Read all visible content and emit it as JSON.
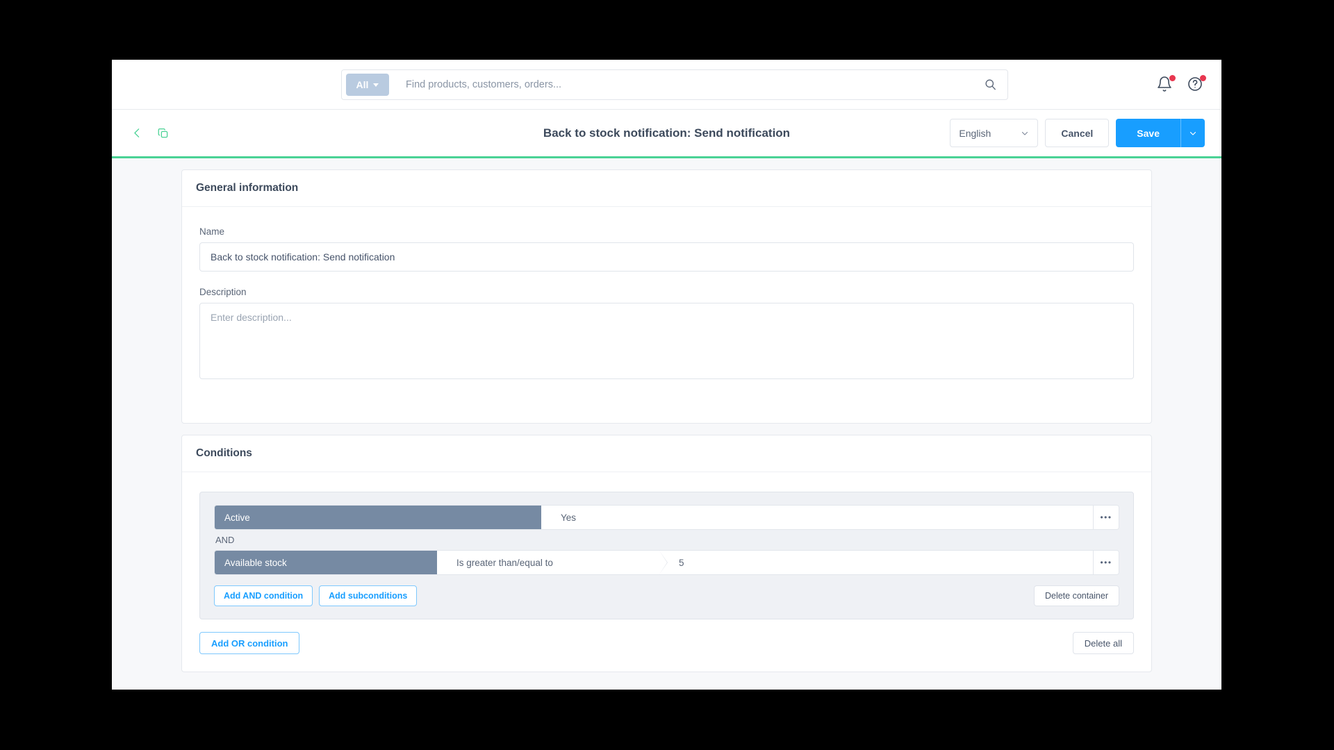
{
  "topbar": {
    "scope_label": "All",
    "search_placeholder": "Find products, customers, orders...",
    "search_value": "",
    "search_icon": "search-icon",
    "notifications_icon": "bell-icon",
    "help_icon": "question-circle-icon"
  },
  "pagebar": {
    "back_icon": "chevron-left-icon",
    "duplicate_icon": "copy-icon",
    "title": "Back to stock notification: Send notification",
    "language": "English",
    "cancel_label": "Cancel",
    "save_label": "Save",
    "save_caret_icon": "chevron-down-icon"
  },
  "general": {
    "heading": "General information",
    "name_label": "Name",
    "name_value": "Back to stock notification: Send notification",
    "description_label": "Description",
    "description_value": "",
    "description_placeholder": "Enter description..."
  },
  "conditions": {
    "heading": "Conditions",
    "rows": [
      {
        "field": "Active",
        "operator": "",
        "value": "Yes",
        "menu": "•••",
        "has_operator": false
      },
      {
        "field": "Available stock",
        "operator": "Is greater than/equal to",
        "value": "5",
        "menu": "•••",
        "has_operator": true
      }
    ],
    "join_label": "AND",
    "add_and_label": "Add AND condition",
    "add_sub_label": "Add subconditions",
    "delete_container_label": "Delete container",
    "bottom_add_label": "Add OR condition",
    "bottom_delete_label": "Delete all"
  },
  "colors": {
    "accent_green": "#4ad295",
    "primary_blue": "#189eff",
    "field_slate": "#768aa3",
    "badge_red": "#e8364f"
  }
}
